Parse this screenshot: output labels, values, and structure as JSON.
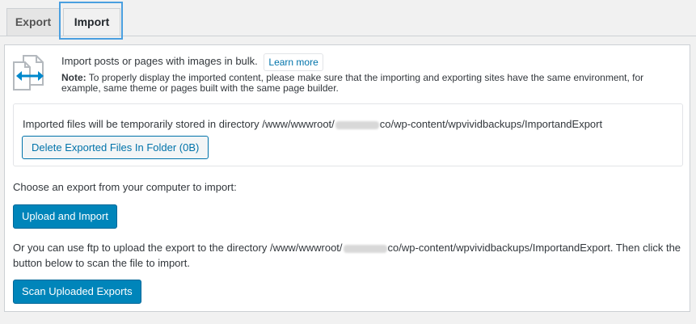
{
  "tabs": [
    {
      "label": "Export",
      "active": false
    },
    {
      "label": "Import",
      "active": true
    }
  ],
  "intro": {
    "text": "Import posts or pages with images in bulk.",
    "learn_more": "Learn more",
    "note_label": "Note:",
    "note_text": "To properly display the imported content, please make sure that the importing and exporting sites have the same environment, for example, same theme or pages built with the same page builder."
  },
  "directory": {
    "text_before": "Imported files will be temporarily stored in directory /www/wwwroot/",
    "text_after": "co/wp-content/wpvividbackups/ImportandExport",
    "delete_button": "Delete Exported Files In Folder (0B)"
  },
  "upload": {
    "prompt": "Choose an export from your computer to import:",
    "button": "Upload and Import"
  },
  "ftp": {
    "text_before": "Or you can use ftp to upload the export to the directory /www/wwwroot/",
    "text_after": "co/wp-content/wpvividbackups/ImportandExport. Then click the button below to scan the file to import.",
    "button": "Scan Uploaded Exports"
  },
  "colors": {
    "primary": "#0085ba",
    "link": "#0073aa",
    "focus_outline": "#4a9fe0",
    "icon_arrow": "#0088cc"
  },
  "icons": [
    "import-file-icon"
  ]
}
